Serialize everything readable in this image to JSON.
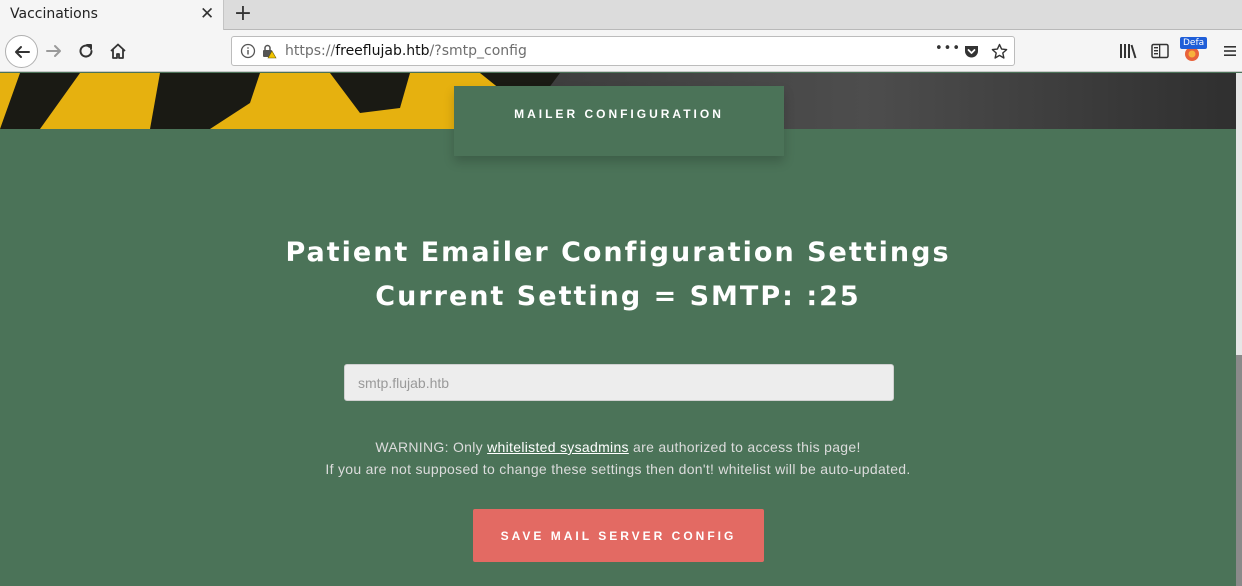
{
  "browser": {
    "tab_title": "Vaccinations",
    "tab_close_glyph": "✕",
    "new_tab_glyph": "+",
    "url_scheme": "https://",
    "url_host": "freeflujab.htb",
    "url_path": "/?smtp_config",
    "more_glyph": "•••",
    "default_badge": "Defa"
  },
  "page": {
    "mailer_tab_label": "MAILER CONFIGURATION",
    "heading_line1": "Patient Emailer Configuration Settings",
    "heading_line2": "Current Setting = SMTP: :25",
    "input_placeholder": "smtp.flujab.htb",
    "warning_prefix": "WARNING: Only ",
    "warning_link": "whitelisted sysadmins",
    "warning_suffix": " are authorized to access this page!",
    "warning_line2": "If you are not supposed to change these settings then don't! whitelist will be auto-updated.",
    "save_button_label": "SAVE MAIL SERVER CONFIG"
  },
  "colors": {
    "page_bg": "#4b7358",
    "button_bg": "#e36a63",
    "browser_chrome": "#f5f5f5"
  }
}
